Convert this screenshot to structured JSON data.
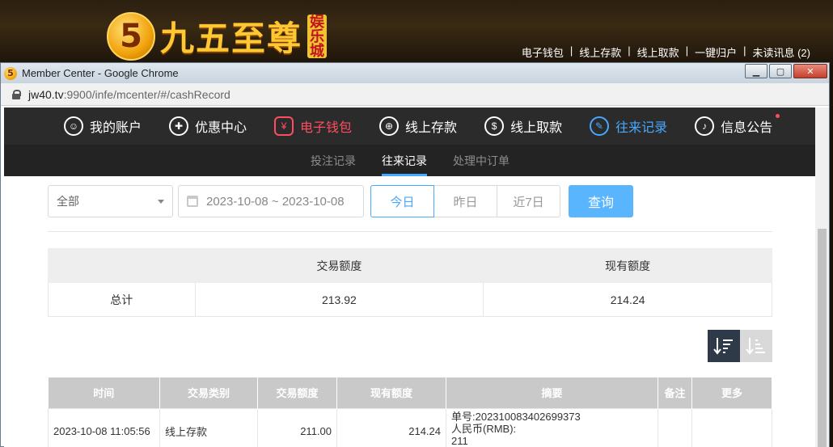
{
  "site": {
    "logo_digit": "5",
    "logo_text": "九五至尊",
    "logo_badge": "娱乐城",
    "links": [
      "电子钱包",
      "线上存款",
      "线上取款",
      "一键归户",
      "未读讯息 (2)"
    ]
  },
  "window": {
    "title": "Member Center - Google Chrome",
    "url_host": "jw40.tv",
    "url_path": ":9900/infe/mcenter/#/cashRecord"
  },
  "nav": {
    "items": [
      {
        "label": "我的账户",
        "icon": "user-icon",
        "glyph": "☺"
      },
      {
        "label": "优惠中心",
        "icon": "gift-icon",
        "glyph": "✚"
      },
      {
        "label": "电子钱包",
        "icon": "wallet-icon",
        "glyph": "¥"
      },
      {
        "label": "线上存款",
        "icon": "deposit-icon",
        "glyph": "⊕"
      },
      {
        "label": "线上取款",
        "icon": "withdraw-icon",
        "glyph": "$"
      },
      {
        "label": "往来记录",
        "icon": "record-icon",
        "glyph": "✎"
      },
      {
        "label": "信息公告",
        "icon": "bell-icon",
        "glyph": "♪"
      }
    ]
  },
  "subnav": {
    "items": [
      "投注记录",
      "往来记录",
      "处理中订单"
    ]
  },
  "filters": {
    "type_selected": "全部",
    "date_range": "2023-10-08 ~ 2023-10-08",
    "quick": [
      "今日",
      "昨日",
      "近7日"
    ],
    "query_label": "查询"
  },
  "summary": {
    "headers": [
      "",
      "交易额度",
      "现有额度"
    ],
    "row_label": "总计",
    "trade_amount": "213.92",
    "current_amount": "214.24"
  },
  "records": {
    "headers": [
      "时间",
      "交易类别",
      "交易额度",
      "现有额度",
      "摘要",
      "备注",
      "更多"
    ],
    "rows": [
      {
        "time": "2023-10-08 11:05:56",
        "type": "线上存款",
        "trade": "211.00",
        "current": "214.24",
        "summary_lines": [
          "单号:202310083402699373",
          "人民币(RMB):",
          "211"
        ],
        "note": "",
        "more": ""
      }
    ]
  },
  "colors": {
    "accent": "#47a8ff",
    "highlight_red": "#ff4d60",
    "nav_bg": "#2b2b2b"
  }
}
